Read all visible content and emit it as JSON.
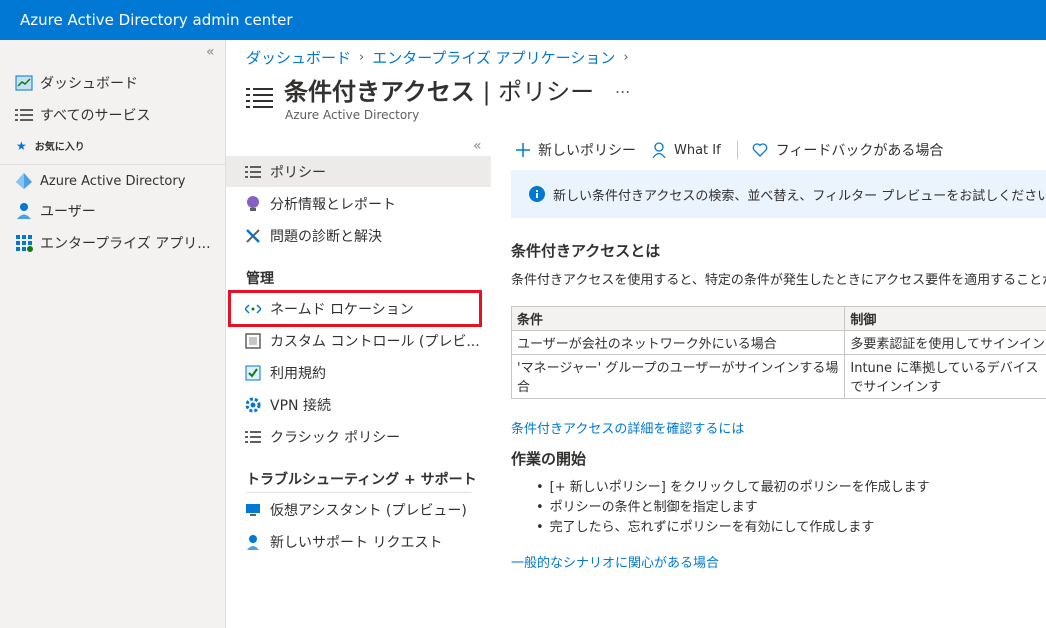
{
  "app": {
    "title": "Azure Active Directory admin center"
  },
  "leftnav": {
    "items": [
      {
        "label": "ダッシュボード"
      },
      {
        "label": "すべてのサービス"
      }
    ],
    "favorites_label": "お気に入り",
    "favorites": [
      {
        "label": "Azure Active Directory"
      },
      {
        "label": "ユーザー"
      },
      {
        "label": "エンタープライズ アプリ..."
      }
    ]
  },
  "breadcrumb": [
    {
      "label": "ダッシュボード"
    },
    {
      "label": "エンタープライズ アプリケーション"
    }
  ],
  "page": {
    "title_bold": "条件付きアクセス",
    "title_rest": " | ポリシー",
    "more": "...",
    "subtitle": "Azure Active Directory"
  },
  "menu": {
    "items": [
      {
        "label": "ポリシー"
      },
      {
        "label": "分析情報とレポート"
      },
      {
        "label": "問題の診断と解決"
      }
    ],
    "manage_header": "管理",
    "manage": [
      {
        "label": "ネームド ロケーション"
      },
      {
        "label": "カスタム コントロール (プレビ..."
      },
      {
        "label": "利用規約"
      },
      {
        "label": "VPN 接続"
      },
      {
        "label": "クラシック ポリシー"
      }
    ],
    "support_header": "トラブルシューティング + サポート",
    "support": [
      {
        "label": "仮想アシスタント (プレビュー)"
      },
      {
        "label": "新しいサポート リクエスト"
      }
    ]
  },
  "toolbar": {
    "new_policy": "新しいポリシー",
    "what_if": "What If",
    "feedback": "フィードバックがある場合"
  },
  "info": {
    "text": "新しい条件付きアクセスの検索、並べ替え、フィルター プレビューをお試しください。"
  },
  "content": {
    "heading1": "条件付きアクセスとは",
    "para1": "条件付きアクセスを使用すると、特定の条件が発生したときにアクセス要件を適用することが",
    "table": {
      "headers": [
        "条件",
        "制御"
      ],
      "rows": [
        [
          "ユーザーが会社のネットワーク外にいる場合",
          "多要素認証を使用してサインイン"
        ],
        [
          "'マネージャー' グループのユーザーがサインインする場合",
          "Intune に準拠しているデバイスでサインインす"
        ]
      ]
    },
    "link1": "条件付きアクセスの詳細を確認するには",
    "heading2": "作業の開始",
    "bullets": [
      "[+ 新しいポリシー] をクリックして最初のポリシーを作成します",
      "ポリシーの条件と制御を指定します",
      "完了したら、忘れずにポリシーを有効にして作成します"
    ],
    "link2": "一般的なシナリオに関心がある場合"
  },
  "colors": {
    "accent": "#0078d4",
    "highlight": "#e81123"
  }
}
